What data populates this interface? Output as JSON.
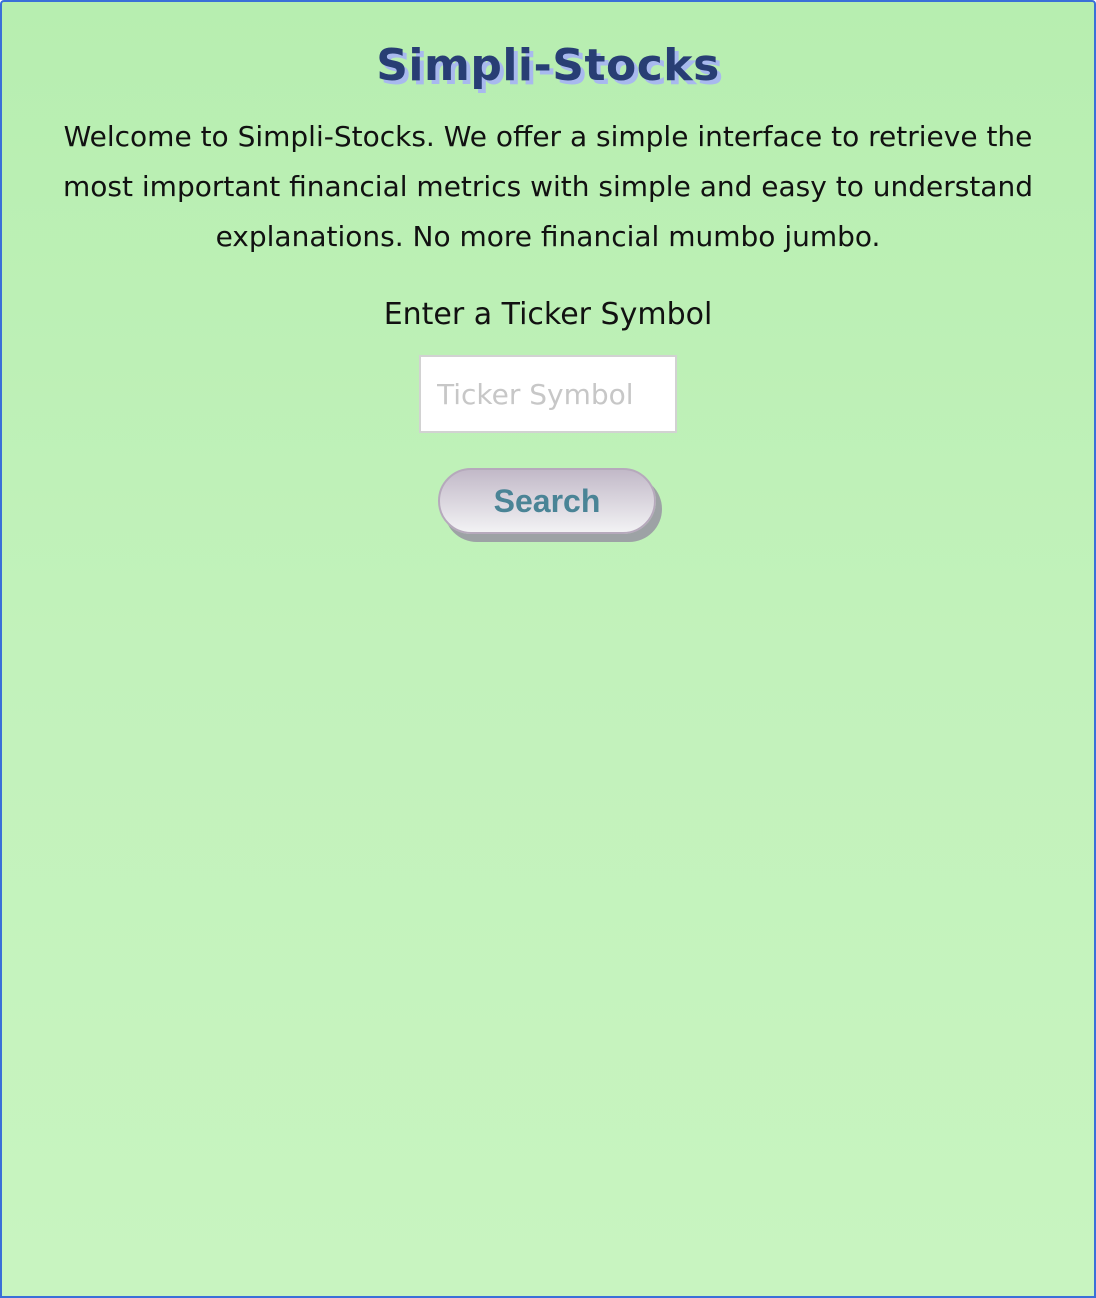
{
  "header": {
    "title": "Simpli-Stocks"
  },
  "intro": {
    "text": "Welcome to Simpli-Stocks. We offer a simple interface to retrieve the most important financial metrics with simple and easy to understand explanations. No more financial mumbo jumbo."
  },
  "search": {
    "label": "Enter a Ticker Symbol",
    "placeholder": "Ticker Symbol",
    "value": "",
    "button_label": "Search"
  },
  "colors": {
    "background_top": "#b7eeb0",
    "background_bottom": "#c8f4c0",
    "title": "#283e74",
    "title_shadow": "#a8b9ee",
    "button_text": "#4a8496",
    "frame_border": "#3a6fd8"
  }
}
